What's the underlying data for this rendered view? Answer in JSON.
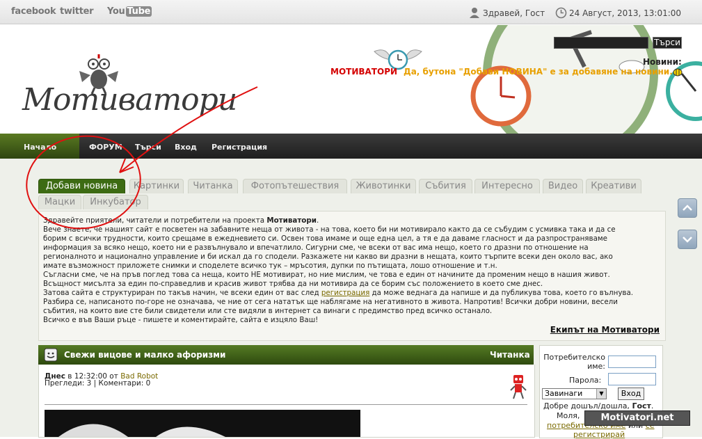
{
  "topbar": {
    "facebook": "facebook",
    "twitter": "twitter",
    "youtube_you": "You",
    "youtube_tube": "Tube",
    "greeting": "Здравей, Гост",
    "datetime": "24 Август, 2013, 13:01:00"
  },
  "header": {
    "logo_text": "Мотиватори",
    "search_button": "Търси",
    "news_label": "Новини:",
    "ticker_red": "МОТИВАТОРИ",
    "ticker_orange": "Да, бутона \"Добави НОВИНА\" е за добавяне на новини."
  },
  "nav": {
    "items": [
      "Начало",
      "ФОРУМ",
      "Търси",
      "Вход",
      "Регистрация"
    ]
  },
  "tabs": [
    "Добави новина",
    "Картинки",
    "Читанка",
    "Фотопътешествия",
    "Животинки",
    "Събития",
    "Интересно",
    "Видео",
    "Креативи",
    "Мацки",
    "Инкубатор"
  ],
  "welcome": {
    "line1_pre": "Здравейте приятели, читатели и потребители на проекта ",
    "line1_bold": "Мотиватори",
    "line1_post": ".",
    "line2": "Вече знаете, че нашият сайт е посветен на забавните неща от живота - на това, което би ни мотивирало както да се събудим с усмивка така и да се",
    "line3": "борим с всички трудности, които срещаме в ежедневието си. Освен това имаме и още една цел, а тя е да даваме гласност и да разпространяваме",
    "line4": "информация за всяко нещо, което ни е развълнувало и впечатлило. Сигурни сме, че всеки от вас има нещо, което го дразни по отношение на",
    "line5": "регионалното и национално управление и би искал да го сподели. Разкажете ни какво ви дразни в нещата, които търпите всеки ден около вас, ако",
    "line6": "имате възможност приложете снимки и споделете всичко тук – мръсотия, дупки по пътищата, лошо отношение и т.н.",
    "line7": "Съгласни сме, че на пръв поглед това са неща, които НЕ мотивират, но ние мислим, че това е един от начините да променим нещо в нашия живот.",
    "line8": "Всъщност мисълта за един по-справедлив и красив живот трябва да ни мотивира да се борим със положението в което сме днес.",
    "line9_pre": "Затова сайта е структуриран по такъв начин, че всеки един от вас след ",
    "line9_link": "регистрация",
    "line9_post": " да може веднага да напише и да публикува това, което го вълнува.",
    "line10": "Разбира се, написаното по-горе не означава, че ние от сега нататък ще наблягаме на негативното в живота. Напротив! Всички добри новини, весели",
    "line11": "събития, на които вие сте били свидетели или сте видяли в интернет са винаги с предимство пред всичко останало.",
    "line12": "Всичко е във Ваши ръце - пишете и коментирайте, сайта е изцяло Ваш!",
    "signature": "Екипът на Мотиватори"
  },
  "post": {
    "title": "Свежи вицове и малко афоризми",
    "category": "Читанка",
    "date_bold": "Днес",
    "date_rest": " в 12:32:00 от ",
    "author": "Bad Robot",
    "stats": "Прегледи: 3 | Коментари: 0"
  },
  "login": {
    "username_label_1": "Потребителско",
    "username_label_2": "име:",
    "password_label": "Парола:",
    "remember_option": "Завинаги",
    "login_button": "Вход",
    "welcome_pre": "Добре дошъл/дошла, ",
    "welcome_bold": "Гост",
    "welcome_post": ".",
    "please_line": "Моля,",
    "line3_link": "потребителско име",
    "line3_mid": " или ",
    "line3_tail": "се",
    "line4_link": "регистрирай"
  },
  "watermark": "Motivatori.net",
  "colors": {
    "nav_active": "#3d6b13",
    "ticker_red": "#d40000",
    "ticker_orange": "#e8a000",
    "post_header": "#3d6b13"
  }
}
